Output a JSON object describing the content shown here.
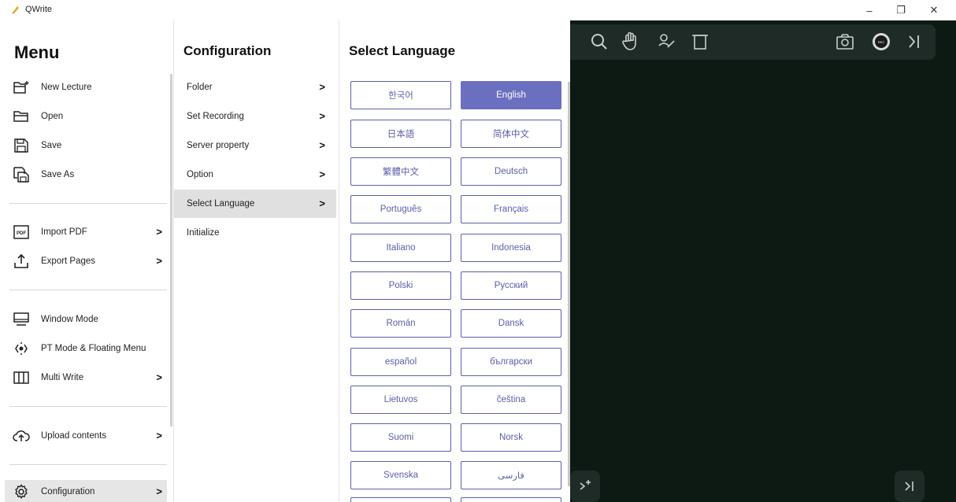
{
  "window": {
    "title": "QWrite",
    "minimize": "–",
    "maximize": "❐",
    "close": "✕"
  },
  "menu": {
    "title": "Menu",
    "items": [
      {
        "label": "New Lecture",
        "icon": "new-lecture-icon"
      },
      {
        "label": "Open",
        "icon": "folder-open-icon"
      },
      {
        "label": "Save",
        "icon": "save-icon"
      },
      {
        "label": "Save As",
        "icon": "save-as-icon"
      },
      {
        "label": "Import PDF",
        "icon": "pdf-icon",
        "arrow": ">"
      },
      {
        "label": "Export Pages",
        "icon": "export-icon",
        "arrow": ">"
      },
      {
        "label": "Window Mode",
        "icon": "monitor-icon"
      },
      {
        "label": "PT Mode & Floating Menu",
        "icon": "floating-menu-icon"
      },
      {
        "label": "Multi Write",
        "icon": "multi-column-icon",
        "arrow": ">"
      },
      {
        "label": "Upload contents",
        "icon": "cloud-upload-icon",
        "arrow": ">"
      },
      {
        "label": "Configuration",
        "icon": "gear-icon",
        "arrow": ">"
      }
    ]
  },
  "configuration": {
    "title": "Configuration",
    "items": [
      {
        "label": "Folder",
        "arrow": ">"
      },
      {
        "label": "Set Recording",
        "arrow": ">"
      },
      {
        "label": "Server property",
        "arrow": ">"
      },
      {
        "label": "Option",
        "arrow": ">"
      },
      {
        "label": "Select Language",
        "arrow": ">"
      },
      {
        "label": "Initialize",
        "arrow": ""
      }
    ]
  },
  "language": {
    "title": "Select Language",
    "selected": "English",
    "accent": "#6b6fbf",
    "options": [
      "한국어",
      "English",
      "日本語",
      "简体中文",
      "繁體中文",
      "Deutsch",
      "Português",
      "Français",
      "Italiano",
      "Indonesia",
      "Polski",
      "Русский",
      "Román",
      "Dansk",
      "español",
      "български",
      "Lietuvos",
      "čeština",
      "Suomi",
      "Norsk",
      "Svenska",
      "فارسی"
    ]
  },
  "toolbar": {
    "icons": [
      "search-icon",
      "hand-icon",
      "group-icon",
      "frame-icon",
      "camera-icon",
      "record-icon",
      "collapse-icon"
    ],
    "record_label": "REC"
  }
}
